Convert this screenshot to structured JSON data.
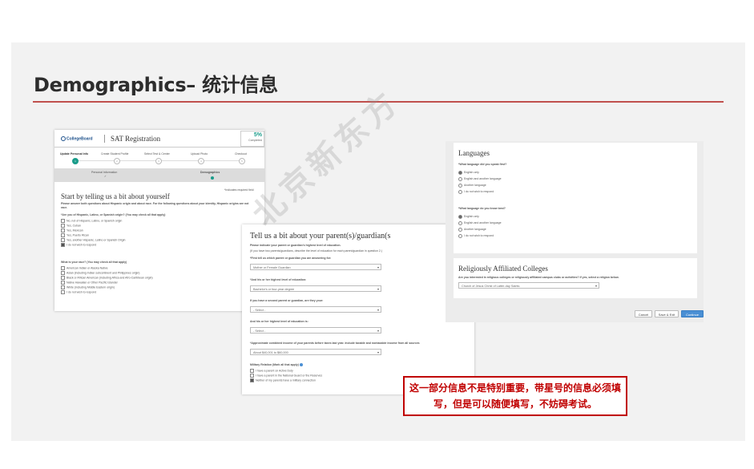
{
  "slide": {
    "title": "Demographics– 统计信息",
    "callout_line1": "这一部分信息不是特别重要，带星号的信息必须填",
    "callout_line2": "写，但是可以随便填写，不妨碍考试。",
    "watermark": "北京新东方",
    "accent_color": "#c0504d"
  },
  "left_panel": {
    "logo": "CollegeBoard",
    "app_title": "SAT Registration",
    "progress_pct": "5%",
    "progress_label": "Completed",
    "steps": [
      "Update Personal Info",
      "Create Student Profile",
      "Select Test & Center",
      "Upload Photo",
      "Checkout"
    ],
    "step_numbers": [
      "1",
      "2",
      "3",
      "4",
      "5"
    ],
    "substeps": [
      "Personal Information",
      "Demographics"
    ],
    "required_note": "*Indicates required field",
    "heading": "Start by telling us a bit about yourself",
    "intro_line1": "Please answer both questions about Hispanic origin and about race. For the following questions about your identity, Hispanic origins are not",
    "intro_line2": "race.",
    "q1": "*Are you of Hispanic, Latino, or Spanish origin? (You may check all that apply)",
    "q1_options": [
      {
        "label": "No, not of Hispanic, Latino, or Spanish origin",
        "checked": false
      },
      {
        "label": "Yes, Cuban",
        "checked": false
      },
      {
        "label": "Yes, Mexican",
        "checked": false
      },
      {
        "label": "Yes, Puerto Rican",
        "checked": false
      },
      {
        "label": "Yes, another Hispanic, Latino or Spanish Origin",
        "checked": false
      },
      {
        "label": "I do not wish to respond",
        "checked": true
      }
    ],
    "q2": "What is your race? (You may check all that apply)",
    "q2_options": [
      {
        "label": "American Indian or Alaska Native",
        "checked": false
      },
      {
        "label": "Asian (including Indian subcontinent and Philippines origin)",
        "checked": false
      },
      {
        "label": "Black or African American (including Africa and Afro-Caribbean origin)",
        "checked": false
      },
      {
        "label": "Native Hawaiian or Other Pacific Islander",
        "checked": false
      },
      {
        "label": "White (including Middle Eastern origin)",
        "checked": false
      },
      {
        "label": "I do not wish to respond",
        "checked": false
      }
    ]
  },
  "middle_panel": {
    "heading": "Tell us a bit about your parent(s)/guardian(s",
    "line1": "Please indicate your parent or guardian's highest level of education.",
    "line2": "(If you have two parents/guardians, describe the level of education for each parent/guardian in question 2.)",
    "q1": "*First tell us which parent or guardian you are answering for:",
    "q1_value": "Mother or Female Guardian",
    "q2": "*And his or her highest level of education:",
    "q2_value": "Bachelor's or four-year degree",
    "q3": "If you have a second parent or guardian, are they your:",
    "q3_value": "- Select -",
    "q4": "And his or her highest level of education is:",
    "q4_value": "- Select -",
    "q5": "*Approximate combined income of your parents before taxes last year. Include taxable and nontaxable income from all sources",
    "q5_value": "About $40,001 to $60,000",
    "q6": "Military Relation (Mark all that apply)",
    "q6_options": [
      {
        "label": "I have a parent on Active Duty",
        "checked": false
      },
      {
        "label": "I have a parent in the National Guard or the Reserves",
        "checked": false
      },
      {
        "label": "Neither of my parents have a military connection",
        "checked": true
      }
    ]
  },
  "right_panel": {
    "languages_heading": "Languages",
    "q1": "*What language did you speak first?",
    "q1_options": [
      {
        "label": "English only",
        "selected": true
      },
      {
        "label": "English and another language",
        "selected": false
      },
      {
        "label": "Another language",
        "selected": false
      },
      {
        "label": "I do not wish to respond",
        "selected": false
      }
    ],
    "q2": "*What language do you know best?",
    "q2_options": [
      {
        "label": "English only",
        "selected": true
      },
      {
        "label": "English and another language",
        "selected": false
      },
      {
        "label": "Another language",
        "selected": false
      },
      {
        "label": "I do not wish to respond",
        "selected": false
      }
    ],
    "colleges_heading": "Religiously Affiliated Colleges",
    "colleges_q": "Are you interested in religious colleges or religiously affiliated campus clubs or activities? If yes, select a religion below.",
    "colleges_value": "Church of Jesus Christ of Latter-day Saints",
    "cancel_label": "Cancel",
    "save_exit_label": "Save & Exit",
    "continue_label": "Continue"
  }
}
